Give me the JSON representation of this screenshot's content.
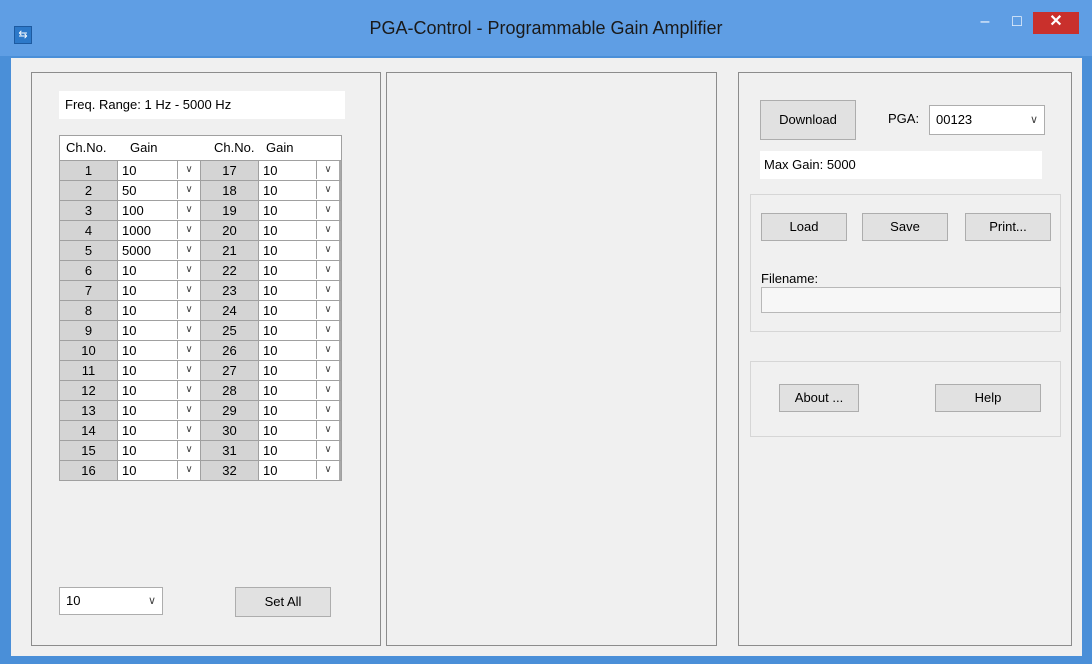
{
  "window": {
    "title": "PGA-Control - Programmable Gain Amplifier",
    "app_icon": "app-icon",
    "controls": {
      "minimize": "–",
      "maximize": "□",
      "close": "✕"
    }
  },
  "left": {
    "freq_label": "Freq. Range: 1 Hz - 5000 Hz",
    "headers": {
      "ch1": "Ch.No.",
      "gain1": "Gain",
      "ch2": "Ch.No.",
      "gain2": "Gain"
    },
    "rows": [
      {
        "a": "1",
        "ga": "10",
        "b": "17",
        "gb": "10"
      },
      {
        "a": "2",
        "ga": "50",
        "b": "18",
        "gb": "10"
      },
      {
        "a": "3",
        "ga": "100",
        "b": "19",
        "gb": "10"
      },
      {
        "a": "4",
        "ga": "1000",
        "b": "20",
        "gb": "10"
      },
      {
        "a": "5",
        "ga": "5000",
        "b": "21",
        "gb": "10"
      },
      {
        "a": "6",
        "ga": "10",
        "b": "22",
        "gb": "10"
      },
      {
        "a": "7",
        "ga": "10",
        "b": "23",
        "gb": "10"
      },
      {
        "a": "8",
        "ga": "10",
        "b": "24",
        "gb": "10"
      },
      {
        "a": "9",
        "ga": "10",
        "b": "25",
        "gb": "10"
      },
      {
        "a": "10",
        "ga": "10",
        "b": "26",
        "gb": "10"
      },
      {
        "a": "11",
        "ga": "10",
        "b": "27",
        "gb": "10"
      },
      {
        "a": "12",
        "ga": "10",
        "b": "28",
        "gb": "10"
      },
      {
        "a": "13",
        "ga": "10",
        "b": "29",
        "gb": "10"
      },
      {
        "a": "14",
        "ga": "10",
        "b": "30",
        "gb": "10"
      },
      {
        "a": "15",
        "ga": "10",
        "b": "31",
        "gb": "10"
      },
      {
        "a": "16",
        "ga": "10",
        "b": "32",
        "gb": "10"
      }
    ],
    "set_all_value": "10",
    "set_all_label": "Set All"
  },
  "right": {
    "download_label": "Download",
    "pga_label": "PGA:",
    "pga_value": "00123",
    "max_gain": "Max Gain: 5000",
    "load_label": "Load",
    "save_label": "Save",
    "print_label": "Print...",
    "filename_label": "Filename:",
    "filename_value": "",
    "about_label": "About ...",
    "help_label": "Help"
  },
  "colors": {
    "titlebar": "#5f9ee4",
    "close_button": "#c9302c",
    "client": "#f0f0f0"
  }
}
